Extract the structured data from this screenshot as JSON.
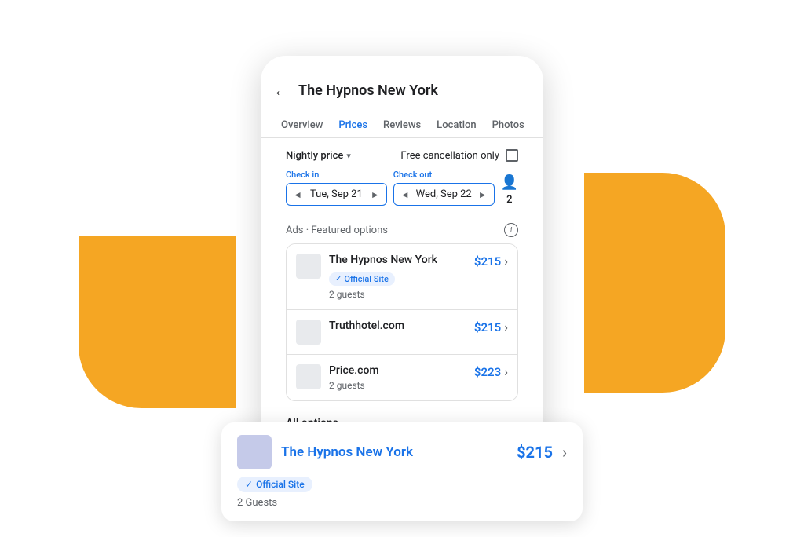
{
  "page": {
    "background": "#f8f9fa"
  },
  "header": {
    "back_label": "←",
    "title": "The Hypnos New York"
  },
  "tabs": [
    {
      "id": "overview",
      "label": "Overview",
      "active": false
    },
    {
      "id": "prices",
      "label": "Prices",
      "active": true
    },
    {
      "id": "reviews",
      "label": "Reviews",
      "active": false
    },
    {
      "id": "location",
      "label": "Location",
      "active": false
    },
    {
      "id": "photos",
      "label": "Photos",
      "active": false
    }
  ],
  "filters": {
    "nightly_price_label": "Nightly price",
    "free_cancel_label": "Free cancellation only"
  },
  "checkin": {
    "label": "Check in",
    "prev": "◄",
    "value": "Tue, Sep 21",
    "next": "►"
  },
  "checkout": {
    "label": "Check out",
    "prev": "◄",
    "value": "Wed, Sep 22",
    "next": "►"
  },
  "guests": {
    "icon": "👤",
    "count": "2"
  },
  "featured_section": {
    "title": "Ads · Featured options",
    "info_label": "i"
  },
  "hotels": [
    {
      "name": "The Hypnos New York",
      "official": true,
      "official_label": "Official Site",
      "guests_label": "2 guests",
      "price": "$215",
      "show_guests": true
    },
    {
      "name": "Truthhotel.com",
      "official": false,
      "official_label": "",
      "guests_label": "",
      "price": "$215",
      "show_guests": false
    },
    {
      "name": "Price.com",
      "official": false,
      "official_label": "",
      "guests_label": "2 guests",
      "price": "$223",
      "show_guests": true
    }
  ],
  "all_options": {
    "label": "All options"
  },
  "bottom_card": {
    "hotel_name": "The Hypnos New York",
    "official_label": "Official Site",
    "price": "$215",
    "guests_label": "2 Guests"
  },
  "orange": {
    "color": "#F5A623"
  }
}
